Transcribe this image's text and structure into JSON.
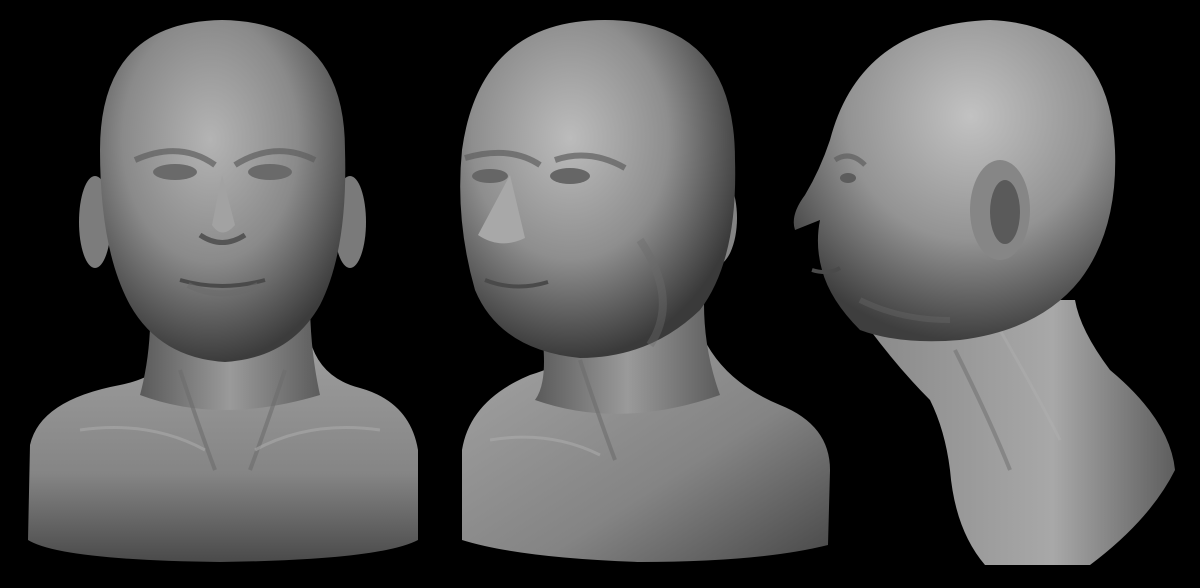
{
  "scene": {
    "background": "#000000",
    "material_light": "#b9b9b9",
    "material_mid": "#7f7f7f",
    "material_dark": "#2e2e2e",
    "views": [
      {
        "id": "front",
        "label": "",
        "view": "front-view"
      },
      {
        "id": "three-quarter",
        "label": "",
        "view": "three-quarter-view"
      },
      {
        "id": "profile",
        "label": "",
        "view": "side-profile-view"
      }
    ]
  }
}
